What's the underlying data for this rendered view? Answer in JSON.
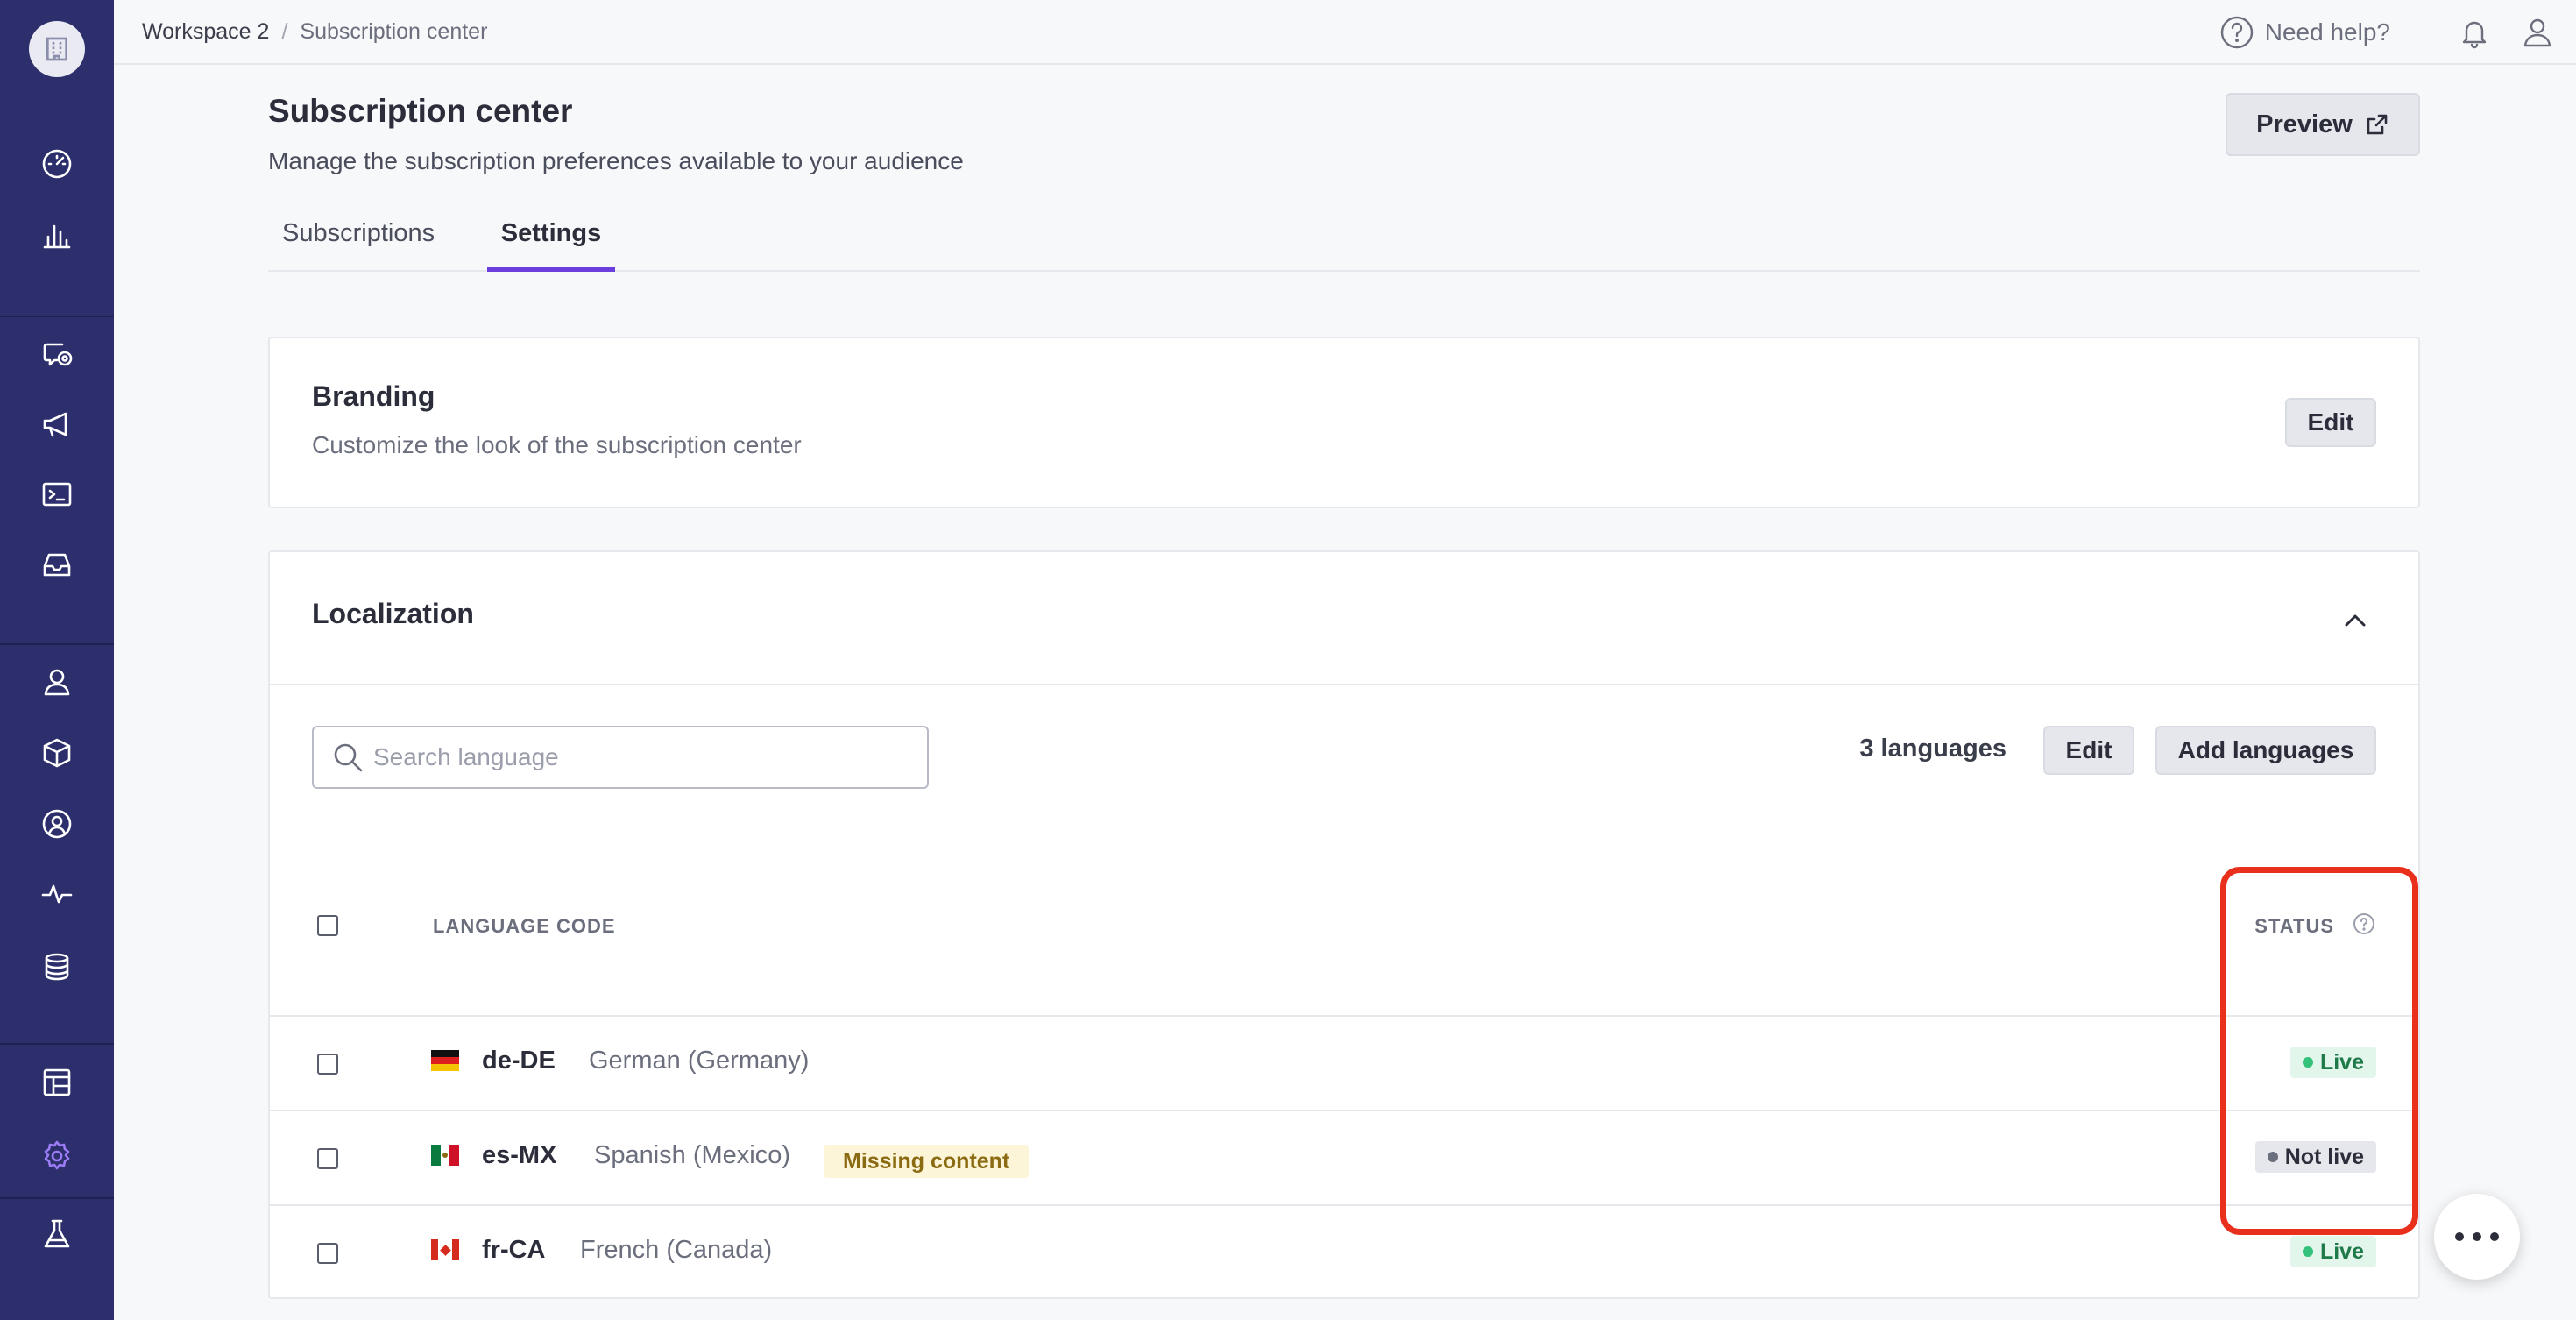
{
  "breadcrumb": {
    "workspace": "Workspace 2",
    "separator": "/",
    "current": "Subscription center"
  },
  "topbar": {
    "help_label": "Need help?",
    "icons": [
      "help-circle-icon",
      "bell-icon",
      "user-icon"
    ]
  },
  "sidebar": {
    "icons": [
      "building-logo-icon",
      "dashboard-gauge-icon",
      "bar-chart-icon",
      "message-target-icon",
      "megaphone-icon",
      "terminal-icon",
      "inbox-icon",
      "person-icon",
      "box-icon",
      "user-circle-icon",
      "activity-icon",
      "database-icon",
      "layout-icon",
      "gear-icon",
      "flask-icon"
    ],
    "active": "gear-icon",
    "colors": {
      "background": "#2c2f6b",
      "active_icon": "#9b7cf6"
    }
  },
  "page": {
    "title": "Subscription center",
    "subtitle": "Manage the subscription preferences available to your audience",
    "preview_label": "Preview"
  },
  "tabs": [
    {
      "label": "Subscriptions",
      "active": false
    },
    {
      "label": "Settings",
      "active": true
    }
  ],
  "branding": {
    "title": "Branding",
    "description": "Customize the look of the subscription center",
    "edit_label": "Edit"
  },
  "localization": {
    "title": "Localization",
    "search_placeholder": "Search language",
    "search_value": "",
    "count_label": "3 languages",
    "edit_label": "Edit",
    "add_label": "Add languages",
    "columns": {
      "code": "LANGUAGE CODE",
      "status": "STATUS"
    },
    "rows": [
      {
        "flag": "germany-flag-icon",
        "code": "de-DE",
        "name": "German (Germany)",
        "badge": "",
        "status": "Live"
      },
      {
        "flag": "mexico-flag-icon",
        "code": "es-MX",
        "name": "Spanish (Mexico)",
        "badge": "Missing content",
        "status": "Not live"
      },
      {
        "flag": "canada-flag-icon",
        "code": "fr-CA",
        "name": "French (Canada)",
        "badge": "",
        "status": "Live"
      }
    ]
  },
  "colors": {
    "accent": "#6a3fdc",
    "live_bg": "#e3f6ec",
    "live_text": "#1f7a4a",
    "live_dot": "#34c27a",
    "notlive_bg": "#e6e7ec",
    "notlive_text": "#2b2d3a",
    "notlive_dot": "#6b6e7c",
    "highlight": "#e8301c"
  }
}
